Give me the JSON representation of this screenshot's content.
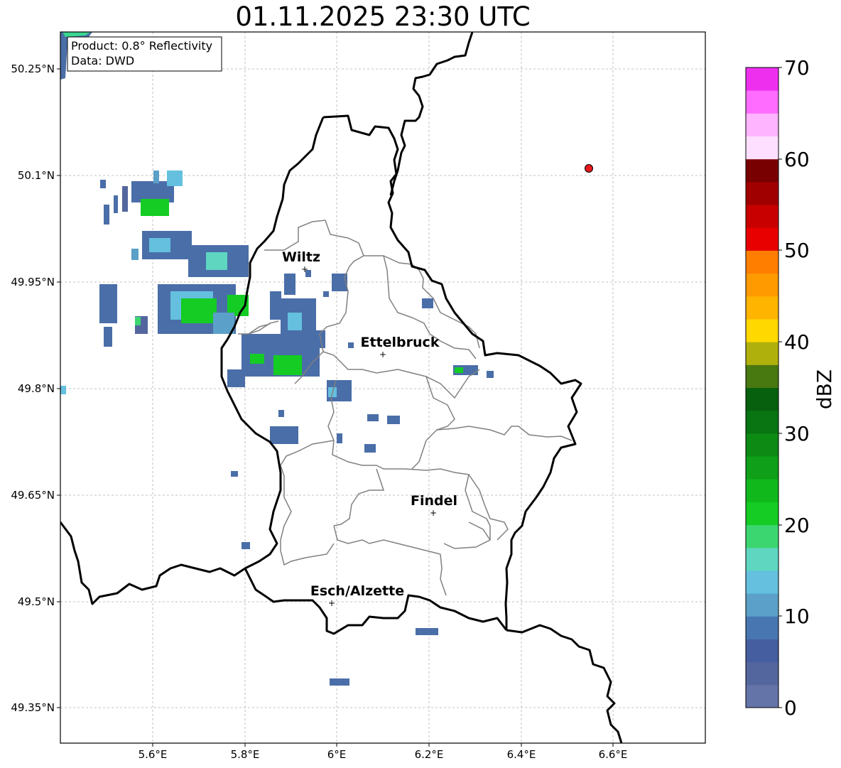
{
  "title": "01.11.2025 23:30 UTC",
  "info": {
    "product": "Product: 0.8° Reflectivity",
    "source": "Data: DWD"
  },
  "lon_ticks": [
    "5.6°E",
    "5.8°E",
    "6°E",
    "6.2°E",
    "6.4°E",
    "6.6°E"
  ],
  "lat_ticks": [
    "50.25°N",
    "50.1°N",
    "49.95°N",
    "49.8°N",
    "49.65°N",
    "49.5°N",
    "49.35°N"
  ],
  "cities": [
    {
      "name": "Wiltz"
    },
    {
      "name": "Ettelbruck"
    },
    {
      "name": "Findel"
    },
    {
      "name": "Esch/Alzette"
    }
  ],
  "colorbar": {
    "label": "dBZ",
    "ticks": [
      "0",
      "10",
      "20",
      "30",
      "40",
      "50",
      "60",
      "70"
    ],
    "colors": [
      "#6473a8",
      "#54669e",
      "#445e9f",
      "#4876b0",
      "#5ba0c8",
      "#64c0de",
      "#5ed6c0",
      "#3cd670",
      "#14cc24",
      "#10b81c",
      "#109f18",
      "#0c8a14",
      "#087412",
      "#06600e",
      "#487810",
      "#b0b00c",
      "#ffd800",
      "#ffb400",
      "#ff9a00",
      "#ff7e00",
      "#e80000",
      "#c80000",
      "#a00000",
      "#780000",
      "#ffdfff",
      "#ffb4ff",
      "#ff6cff",
      "#ee30ee"
    ]
  },
  "colors": {
    "border_national": "#000000",
    "border_canton": "#808080",
    "grid": "#b0b0b0",
    "marker": "#e41a1c"
  }
}
